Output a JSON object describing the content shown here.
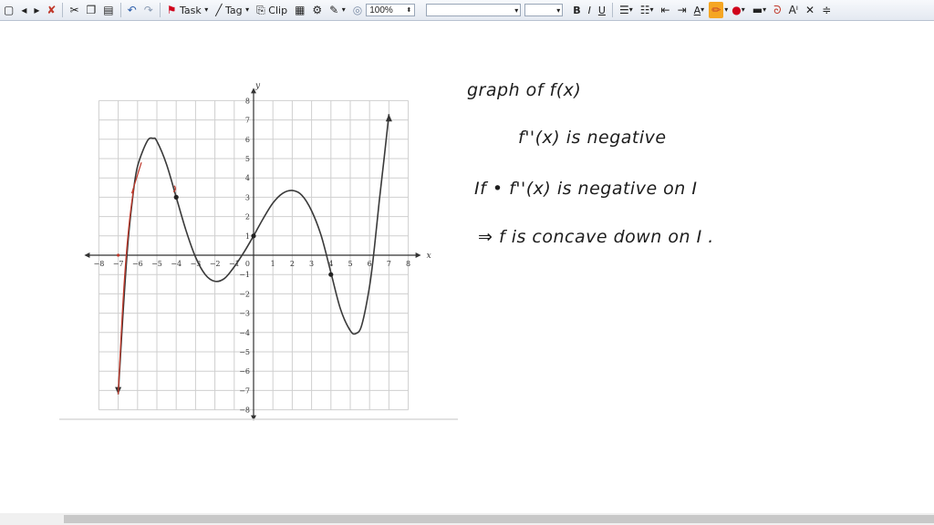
{
  "toolbar": {
    "task_label": "Task",
    "tag_label": "Tag",
    "clip_label": "Clip",
    "zoom_value": "100%",
    "bold_label": "B",
    "italic_label": "I",
    "underline_label": "U",
    "text_size_label": "A",
    "highlight_color": "#f5a623",
    "font_color": "#d0021b"
  },
  "chart_data": {
    "type": "line",
    "xlabel": "x",
    "ylabel": "y",
    "xlim": [
      -8,
      8
    ],
    "ylim": [
      -8,
      8
    ],
    "x_ticks": [
      -8,
      -7,
      -6,
      -5,
      -4,
      -3,
      -2,
      -1,
      1,
      2,
      3,
      4,
      5,
      6,
      7,
      8
    ],
    "y_ticks": [
      -8,
      -7,
      -6,
      -5,
      -4,
      -3,
      -2,
      -1,
      1,
      2,
      3,
      4,
      5,
      6,
      7,
      8
    ],
    "origin_label": "0",
    "grid": true,
    "curve_points": [
      [
        -7,
        -7.2
      ],
      [
        -6.75,
        -3.0
      ],
      [
        -6.5,
        0.6
      ],
      [
        -6.25,
        3.0
      ],
      [
        -6,
        4.6
      ],
      [
        -5.5,
        5.9
      ],
      [
        -5.2,
        6.05
      ],
      [
        -5,
        5.9
      ],
      [
        -4.5,
        4.7
      ],
      [
        -4,
        3.0
      ],
      [
        -3.5,
        1.3
      ],
      [
        -3,
        -0.1
      ],
      [
        -2.5,
        -1.0
      ],
      [
        -2,
        -1.35
      ],
      [
        -1.5,
        -1.2
      ],
      [
        -1,
        -0.6
      ],
      [
        -0.5,
        0.15
      ],
      [
        0,
        1.0
      ],
      [
        0.5,
        1.9
      ],
      [
        1,
        2.7
      ],
      [
        1.5,
        3.2
      ],
      [
        2,
        3.35
      ],
      [
        2.5,
        3.1
      ],
      [
        3,
        2.3
      ],
      [
        3.5,
        1.0
      ],
      [
        4,
        -0.9
      ],
      [
        4.5,
        -2.8
      ],
      [
        5,
        -3.9
      ],
      [
        5.3,
        -4.05
      ],
      [
        5.6,
        -3.6
      ],
      [
        6,
        -1.6
      ],
      [
        6.25,
        0.4
      ],
      [
        6.5,
        2.8
      ],
      [
        6.75,
        5.0
      ],
      [
        7,
        7.3
      ]
    ],
    "marked_points": [
      [
        -4,
        3
      ],
      [
        0,
        1
      ],
      [
        4,
        -1
      ]
    ],
    "arrow_ends": [
      [
        -7,
        -7.2
      ],
      [
        7,
        7.3
      ]
    ]
  },
  "notes": [
    {
      "text": "graph of f(x)"
    },
    {
      "text": "f''(x) is negative"
    },
    {
      "text": "If • f''(x) is negative on I"
    },
    {
      "text": "⇒ f is concave down on I ."
    }
  ]
}
